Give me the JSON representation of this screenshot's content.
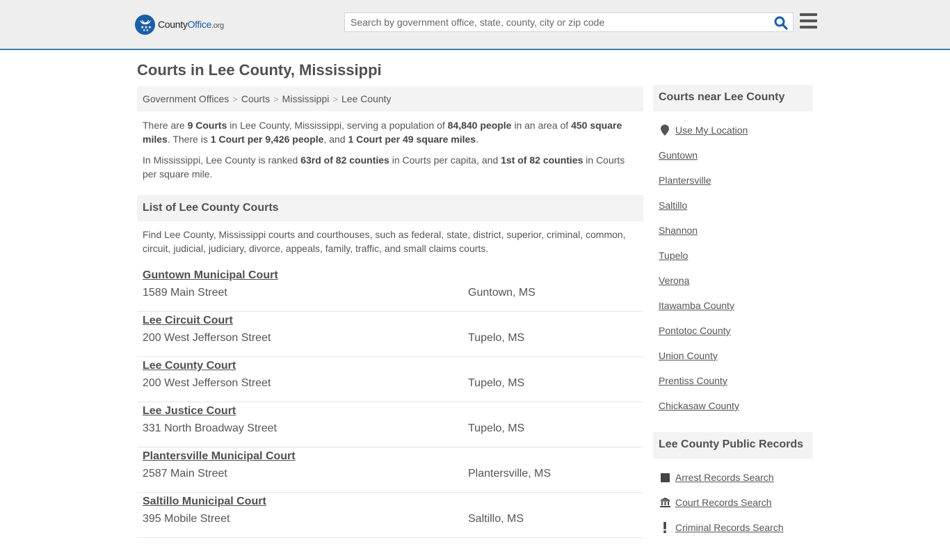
{
  "header": {
    "logo": {
      "name_part1": "County",
      "name_part2": "Office",
      "suffix": ".org"
    },
    "search": {
      "placeholder": "Search by government office, state, county, city or zip code",
      "value": ""
    },
    "search_icon": "search-icon",
    "menu_icon": "hamburger-menu-icon"
  },
  "page": {
    "title": "Courts in Lee County, Mississippi",
    "breadcrumb": [
      "Government Offices",
      "Courts",
      "Mississippi",
      "Lee County"
    ],
    "intro": {
      "p1": {
        "t1": "There are ",
        "b1": "9 Courts",
        "t2": " in Lee County, Mississippi, serving a population of ",
        "b2": "84,840 people",
        "t3": " in an area of ",
        "b3": "450 square miles",
        "t4": ". There is ",
        "b4": "1 Court per 9,426 people",
        "t5": ", and ",
        "b5": "1 Court per 49 square miles",
        "t6": "."
      },
      "p2": {
        "t1": "In Mississippi, Lee County is ranked ",
        "b1": "63rd of 82 counties",
        "t2": " in Courts per capita, and ",
        "b2": "1st of 82 counties",
        "t3": " in Courts per square mile."
      }
    },
    "list_section": {
      "heading": "List of Lee County Courts",
      "description": "Find Lee County, Mississippi courts and courthouses, such as federal, state, district, superior, criminal, common, circuit, judicial, judiciary, divorce, appeals, family, traffic, and small claims courts."
    },
    "courts": [
      {
        "name": "Guntown Municipal Court",
        "address": "1589 Main Street",
        "city": "Guntown, MS"
      },
      {
        "name": "Lee Circuit Court",
        "address": "200 West Jefferson Street",
        "city": "Tupelo, MS"
      },
      {
        "name": "Lee County Court",
        "address": "200 West Jefferson Street",
        "city": "Tupelo, MS"
      },
      {
        "name": "Lee Justice Court",
        "address": "331 North Broadway Street",
        "city": "Tupelo, MS"
      },
      {
        "name": "Plantersville Municipal Court",
        "address": "2587 Main Street",
        "city": "Plantersville, MS"
      },
      {
        "name": "Saltillo Municipal Court",
        "address": "395 Mobile Street",
        "city": "Saltillo, MS"
      }
    ]
  },
  "sidebar": {
    "nearby": {
      "heading": "Courts near Lee County",
      "use_location": {
        "label": "Use My Location",
        "icon": "map-marker-icon"
      },
      "items": [
        "Guntown",
        "Plantersville",
        "Saltillo",
        "Shannon",
        "Tupelo",
        "Verona",
        "Itawamba County",
        "Pontotoc County",
        "Union County",
        "Prentiss County",
        "Chickasaw County"
      ]
    },
    "records": {
      "heading": "Lee County Public Records",
      "items": [
        {
          "label": "Arrest Records Search",
          "icon": "square-icon"
        },
        {
          "label": "Court Records Search",
          "icon": "courthouse-icon"
        },
        {
          "label": "Criminal Records Search",
          "icon": "exclamation-icon"
        }
      ]
    }
  },
  "colors": {
    "brand_blue": "#1b5ea6",
    "header_border": "#3a7fb0",
    "header_bg": "#eeeeee",
    "panel_bg": "#f3f3f3"
  }
}
